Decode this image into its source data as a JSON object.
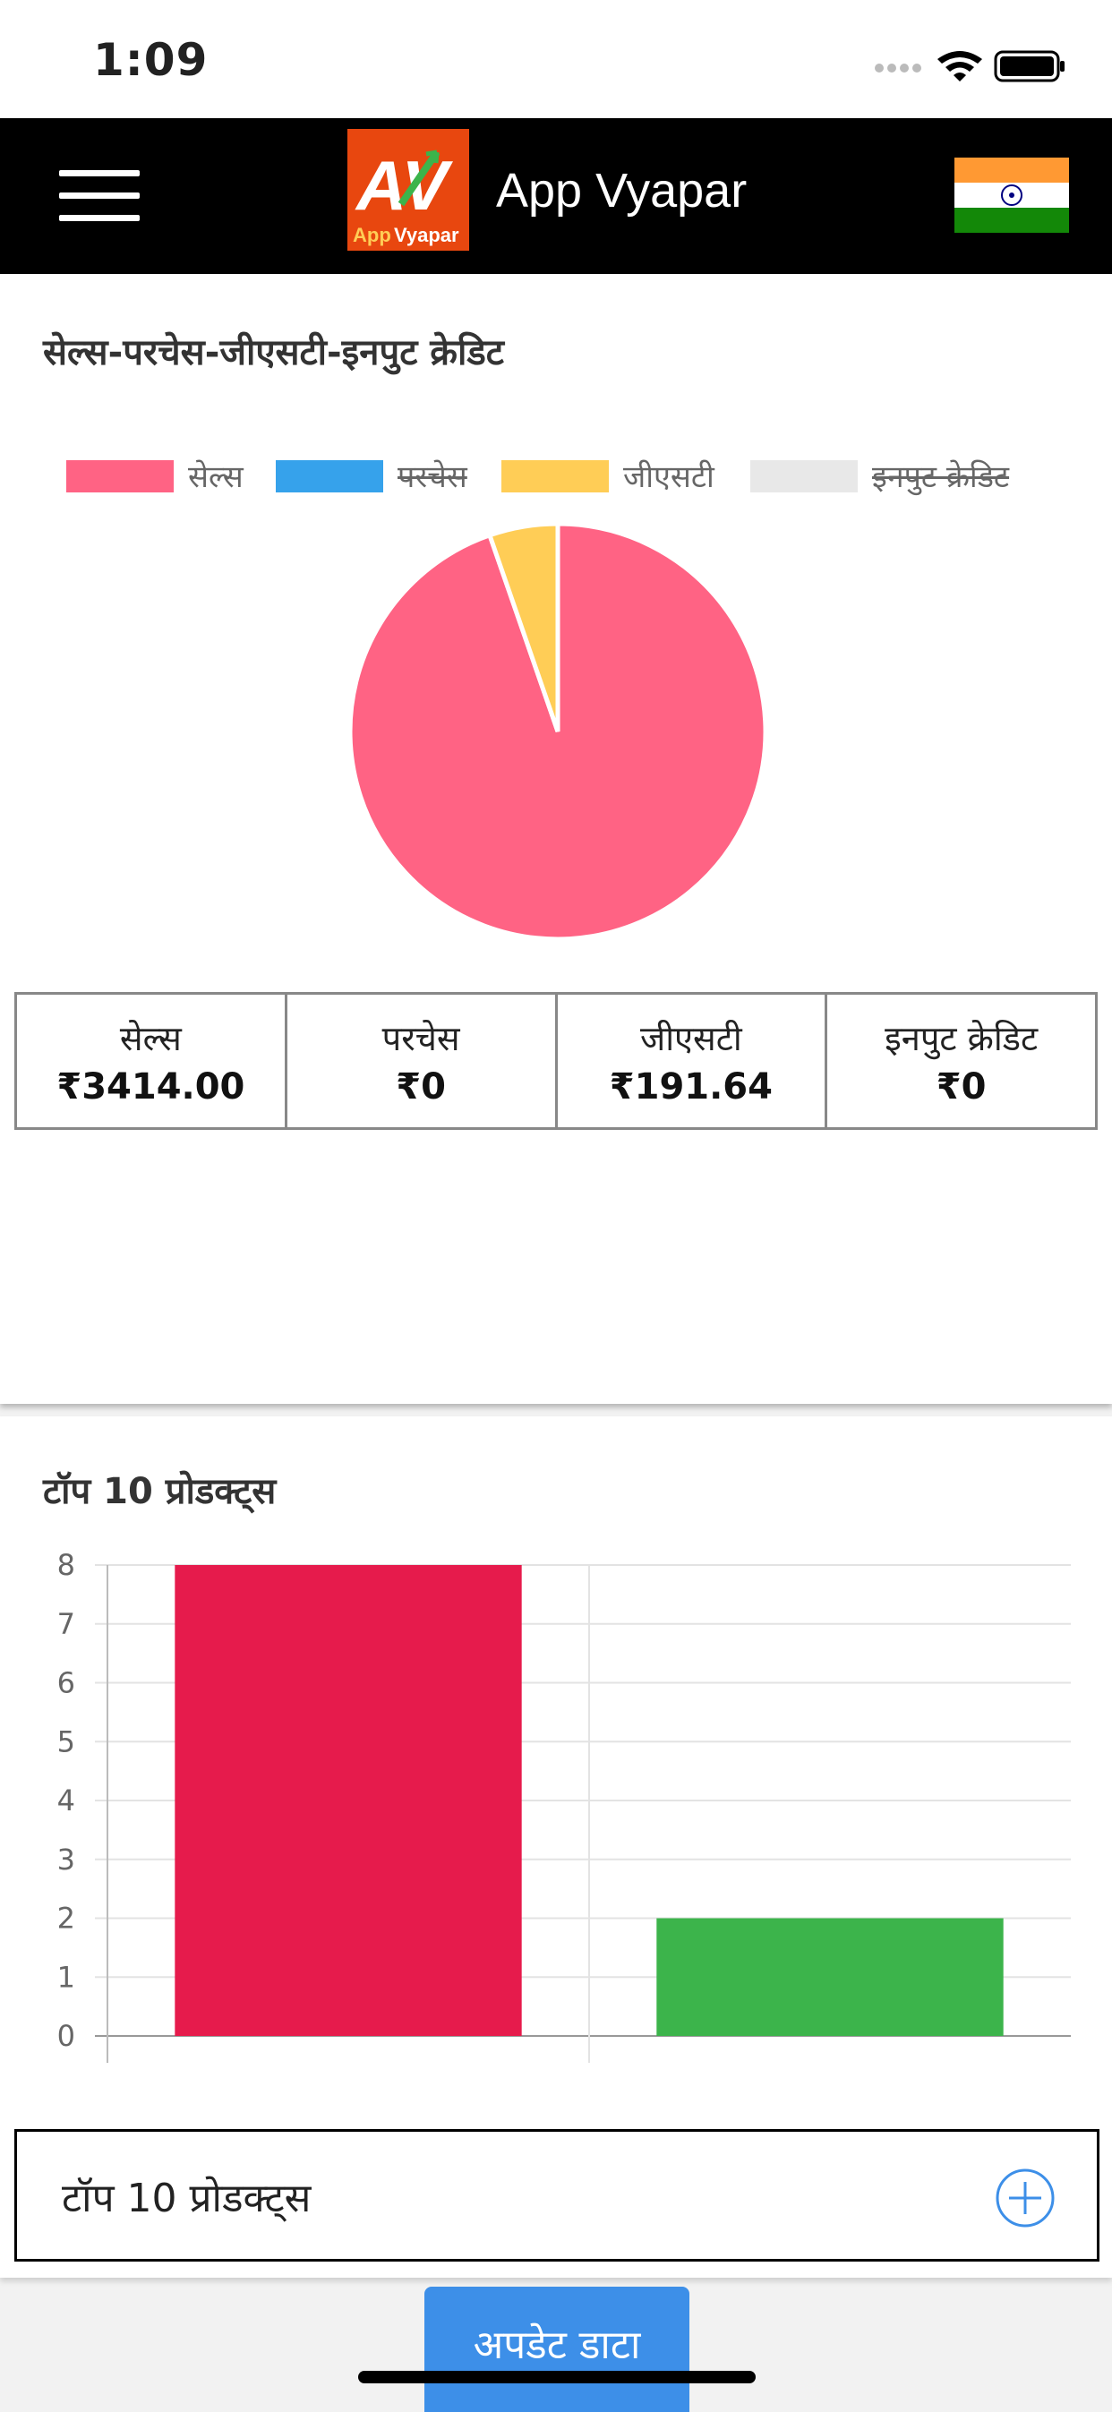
{
  "status_bar": {
    "time": "1:09"
  },
  "header": {
    "app_title": "App Vyapar",
    "logo_initials": "AV",
    "logo_text_1": "App",
    "logo_text_2": "Vyapar"
  },
  "card1": {
    "title": "सेल्स-परचेस-जीएसटी-इनपुट क्रेडिट",
    "summary": [
      {
        "label": "सेल्स",
        "value": "₹3414.00"
      },
      {
        "label": "परचेस",
        "value": "₹0"
      },
      {
        "label": "जीएसटी",
        "value": "₹191.64"
      },
      {
        "label": "इनपुट क्रेडिट",
        "value": "₹0"
      }
    ]
  },
  "chart_data": [
    {
      "type": "pie",
      "legend_position": "top",
      "series": [
        {
          "name": "सेल्स",
          "value": 3414.0,
          "color": "#ff6384",
          "hidden": false
        },
        {
          "name": "परचेस",
          "value": 0,
          "color": "#36a2eb",
          "hidden": true
        },
        {
          "name": "जीएसटी",
          "value": 191.64,
          "color": "#ffcd56",
          "hidden": false
        },
        {
          "name": "इनपुट क्रेडिट",
          "value": 0,
          "color": "#e8e8e8",
          "hidden": true
        }
      ]
    },
    {
      "type": "bar",
      "categories": [
        "",
        ""
      ],
      "values": [
        8,
        2
      ],
      "colors": [
        "#e61b4c",
        "#3cb44b"
      ],
      "ylim": [
        0,
        8
      ],
      "yticks": [
        0,
        1,
        2,
        3,
        4,
        5,
        6,
        7,
        8
      ],
      "grid": true
    }
  ],
  "card2": {
    "title": "टॉप 10 प्रोडक्ट्स",
    "accordion_label": "टॉप 10 प्रोडक्ट्स"
  },
  "footer": {
    "update_button": "अपडेट डाटा"
  },
  "colors": {
    "accent": "#3d8fe8",
    "header_bg": "#000000",
    "logo_bg": "#e8470f"
  }
}
